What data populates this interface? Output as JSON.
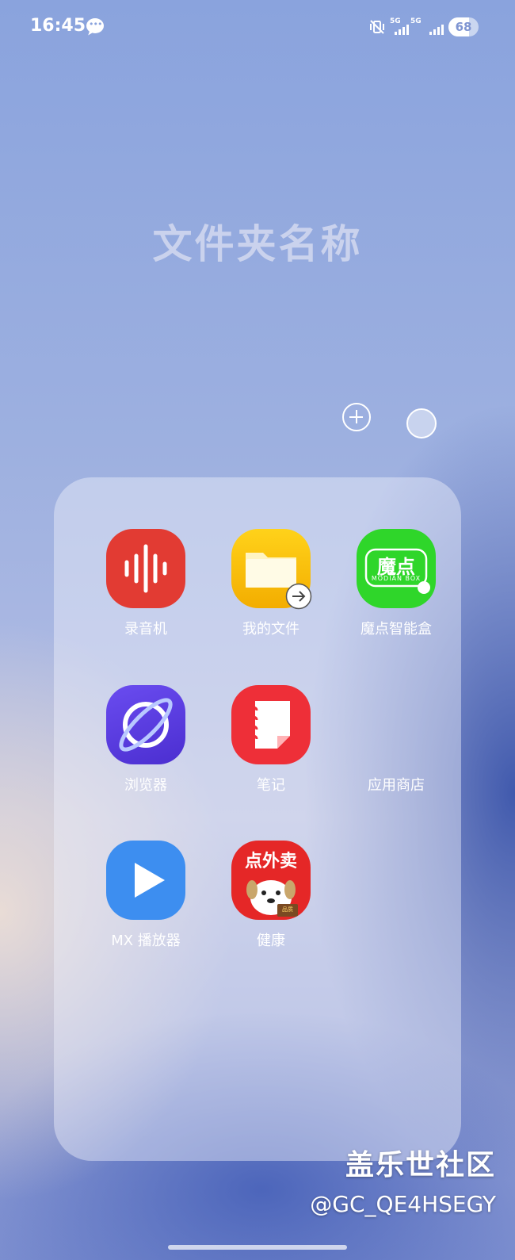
{
  "status": {
    "time": "16:45",
    "message_icon": "chat-bubble-icon",
    "mute_icon": "vibrate-mute-icon",
    "sim1_net": "5G",
    "sim2_net": "5G",
    "battery_percent": 68
  },
  "folder": {
    "title": "文件夹名称",
    "add_icon": "plus-circle-icon",
    "color_icon": "color-circle-icon",
    "apps": [
      {
        "label": "录音机",
        "icon": "voice-recorder-icon"
      },
      {
        "label": "我的文件",
        "icon": "my-files-icon",
        "badge": "arrow-right-icon"
      },
      {
        "label": "魔点智能盒",
        "icon": "modian-box-icon",
        "icon_text": "魔点",
        "icon_subtext": "MODIAN BOX"
      },
      {
        "label": "浏览器",
        "icon": "browser-icon"
      },
      {
        "label": "笔记",
        "icon": "notes-icon"
      },
      {
        "label": "应用商店",
        "icon": "app-store-icon"
      },
      {
        "label": "MX 播放器",
        "icon": "mx-player-icon"
      },
      {
        "label": "健康",
        "icon": "jd-delivery-icon",
        "icon_text": "点外卖",
        "icon_subtext": "品质"
      }
    ]
  },
  "watermark": {
    "title": "盖乐世社区",
    "user": "@GC_QE4HSEGY"
  },
  "colors": {
    "recorder": "#e23b33",
    "files": "#f5b800",
    "modian": "#2fd62a",
    "browser": "#5a3ee0",
    "notes": "#ee2f38",
    "mx": "#3d8ef0",
    "jd": "#e52727"
  }
}
